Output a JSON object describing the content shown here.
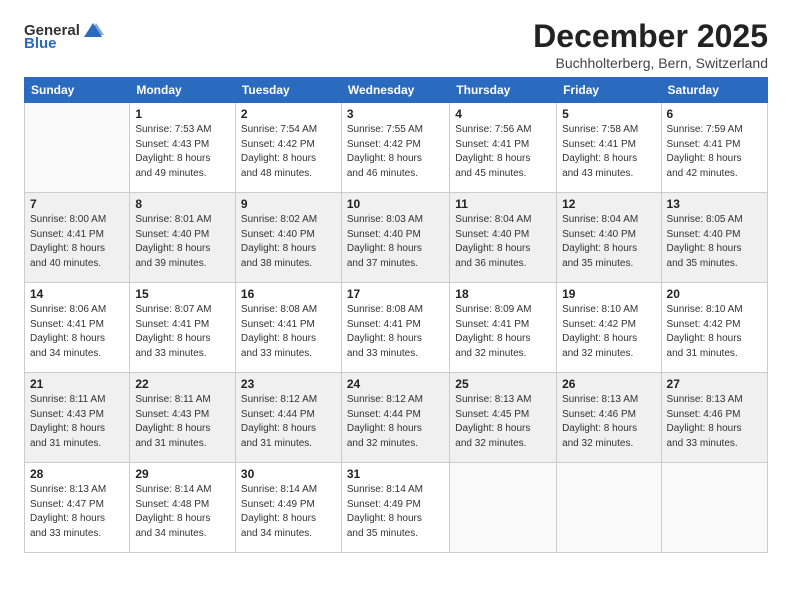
{
  "logo": {
    "general": "General",
    "blue": "Blue"
  },
  "title": "December 2025",
  "location": "Buchholterberg, Bern, Switzerland",
  "days_of_week": [
    "Sunday",
    "Monday",
    "Tuesday",
    "Wednesday",
    "Thursday",
    "Friday",
    "Saturday"
  ],
  "weeks": [
    [
      {
        "day": "",
        "info": ""
      },
      {
        "day": "1",
        "info": "Sunrise: 7:53 AM\nSunset: 4:43 PM\nDaylight: 8 hours\nand 49 minutes."
      },
      {
        "day": "2",
        "info": "Sunrise: 7:54 AM\nSunset: 4:42 PM\nDaylight: 8 hours\nand 48 minutes."
      },
      {
        "day": "3",
        "info": "Sunrise: 7:55 AM\nSunset: 4:42 PM\nDaylight: 8 hours\nand 46 minutes."
      },
      {
        "day": "4",
        "info": "Sunrise: 7:56 AM\nSunset: 4:41 PM\nDaylight: 8 hours\nand 45 minutes."
      },
      {
        "day": "5",
        "info": "Sunrise: 7:58 AM\nSunset: 4:41 PM\nDaylight: 8 hours\nand 43 minutes."
      },
      {
        "day": "6",
        "info": "Sunrise: 7:59 AM\nSunset: 4:41 PM\nDaylight: 8 hours\nand 42 minutes."
      }
    ],
    [
      {
        "day": "7",
        "info": "Sunrise: 8:00 AM\nSunset: 4:41 PM\nDaylight: 8 hours\nand 40 minutes."
      },
      {
        "day": "8",
        "info": "Sunrise: 8:01 AM\nSunset: 4:40 PM\nDaylight: 8 hours\nand 39 minutes."
      },
      {
        "day": "9",
        "info": "Sunrise: 8:02 AM\nSunset: 4:40 PM\nDaylight: 8 hours\nand 38 minutes."
      },
      {
        "day": "10",
        "info": "Sunrise: 8:03 AM\nSunset: 4:40 PM\nDaylight: 8 hours\nand 37 minutes."
      },
      {
        "day": "11",
        "info": "Sunrise: 8:04 AM\nSunset: 4:40 PM\nDaylight: 8 hours\nand 36 minutes."
      },
      {
        "day": "12",
        "info": "Sunrise: 8:04 AM\nSunset: 4:40 PM\nDaylight: 8 hours\nand 35 minutes."
      },
      {
        "day": "13",
        "info": "Sunrise: 8:05 AM\nSunset: 4:40 PM\nDaylight: 8 hours\nand 35 minutes."
      }
    ],
    [
      {
        "day": "14",
        "info": "Sunrise: 8:06 AM\nSunset: 4:41 PM\nDaylight: 8 hours\nand 34 minutes."
      },
      {
        "day": "15",
        "info": "Sunrise: 8:07 AM\nSunset: 4:41 PM\nDaylight: 8 hours\nand 33 minutes."
      },
      {
        "day": "16",
        "info": "Sunrise: 8:08 AM\nSunset: 4:41 PM\nDaylight: 8 hours\nand 33 minutes."
      },
      {
        "day": "17",
        "info": "Sunrise: 8:08 AM\nSunset: 4:41 PM\nDaylight: 8 hours\nand 33 minutes."
      },
      {
        "day": "18",
        "info": "Sunrise: 8:09 AM\nSunset: 4:41 PM\nDaylight: 8 hours\nand 32 minutes."
      },
      {
        "day": "19",
        "info": "Sunrise: 8:10 AM\nSunset: 4:42 PM\nDaylight: 8 hours\nand 32 minutes."
      },
      {
        "day": "20",
        "info": "Sunrise: 8:10 AM\nSunset: 4:42 PM\nDaylight: 8 hours\nand 31 minutes."
      }
    ],
    [
      {
        "day": "21",
        "info": "Sunrise: 8:11 AM\nSunset: 4:43 PM\nDaylight: 8 hours\nand 31 minutes."
      },
      {
        "day": "22",
        "info": "Sunrise: 8:11 AM\nSunset: 4:43 PM\nDaylight: 8 hours\nand 31 minutes."
      },
      {
        "day": "23",
        "info": "Sunrise: 8:12 AM\nSunset: 4:44 PM\nDaylight: 8 hours\nand 31 minutes."
      },
      {
        "day": "24",
        "info": "Sunrise: 8:12 AM\nSunset: 4:44 PM\nDaylight: 8 hours\nand 32 minutes."
      },
      {
        "day": "25",
        "info": "Sunrise: 8:13 AM\nSunset: 4:45 PM\nDaylight: 8 hours\nand 32 minutes."
      },
      {
        "day": "26",
        "info": "Sunrise: 8:13 AM\nSunset: 4:46 PM\nDaylight: 8 hours\nand 32 minutes."
      },
      {
        "day": "27",
        "info": "Sunrise: 8:13 AM\nSunset: 4:46 PM\nDaylight: 8 hours\nand 33 minutes."
      }
    ],
    [
      {
        "day": "28",
        "info": "Sunrise: 8:13 AM\nSunset: 4:47 PM\nDaylight: 8 hours\nand 33 minutes."
      },
      {
        "day": "29",
        "info": "Sunrise: 8:14 AM\nSunset: 4:48 PM\nDaylight: 8 hours\nand 34 minutes."
      },
      {
        "day": "30",
        "info": "Sunrise: 8:14 AM\nSunset: 4:49 PM\nDaylight: 8 hours\nand 34 minutes."
      },
      {
        "day": "31",
        "info": "Sunrise: 8:14 AM\nSunset: 4:49 PM\nDaylight: 8 hours\nand 35 minutes."
      },
      {
        "day": "",
        "info": ""
      },
      {
        "day": "",
        "info": ""
      },
      {
        "day": "",
        "info": ""
      }
    ]
  ]
}
